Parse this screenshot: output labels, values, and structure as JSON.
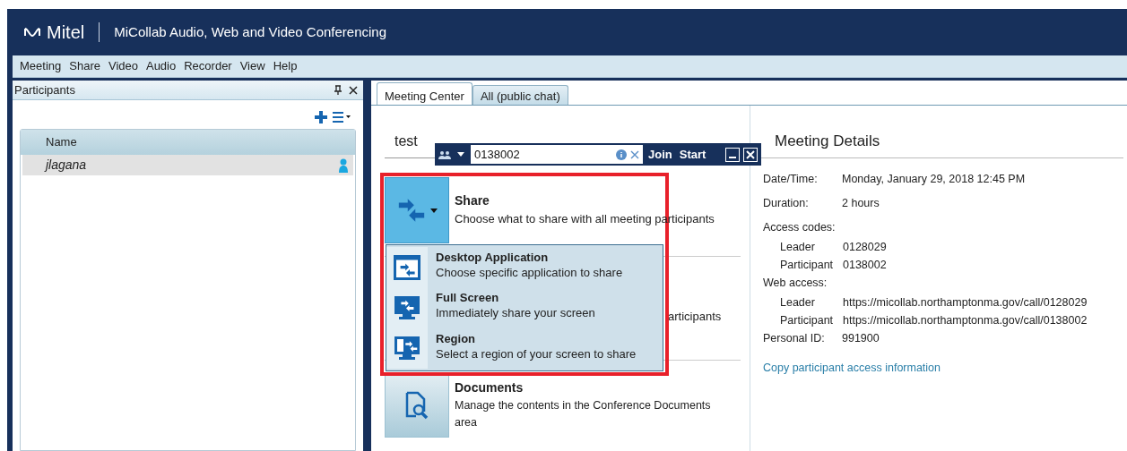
{
  "window": {
    "logo": "Mitel",
    "title": "MiCollab Audio, Web and Video Conferencing"
  },
  "menu": [
    "Meeting",
    "Share",
    "Video",
    "Audio",
    "Recorder",
    "View",
    "Help"
  ],
  "participants": {
    "title": "Participants",
    "column": "Name",
    "rows": [
      {
        "name": "jlagana",
        "selected": true
      }
    ]
  },
  "tabs": [
    {
      "label": "Meeting Center",
      "selected": true
    },
    {
      "label": "All (public chat)",
      "selected": false
    }
  ],
  "meeting": {
    "title": "test",
    "hidden_text": "articipants",
    "cards": [
      {
        "kind": "share",
        "title": "Share",
        "description": "Choose what to share with all meeting participants"
      },
      {
        "kind": "documents",
        "title": "Documents",
        "description": "Manage the contents in the Conference Documents area"
      }
    ]
  },
  "quick_bar": {
    "value": "0138002",
    "buttons": [
      "Join",
      "Start"
    ]
  },
  "share_menu": [
    {
      "kind": "application",
      "title": "Desktop Application",
      "description": "Choose specific application to share"
    },
    {
      "kind": "screen",
      "title": "Full Screen",
      "description": "Immediately share your screen"
    },
    {
      "kind": "region",
      "title": "Region",
      "description": "Select a region of your screen to share"
    }
  ],
  "details": {
    "title": "Meeting Details",
    "rows": [
      {
        "kind": "field",
        "label": "Date/Time:",
        "value": "Monday, January 29, 2018 12:45 PM"
      },
      {
        "kind": "field",
        "label": "Duration:",
        "value": "2 hours"
      },
      {
        "kind": "heading",
        "label": "Access codes:"
      },
      {
        "kind": "sub",
        "label": "Leader",
        "value": "0128029"
      },
      {
        "kind": "sub",
        "label": "Participant",
        "value": "0138002"
      },
      {
        "kind": "heading",
        "label": "Web access:"
      },
      {
        "kind": "sub",
        "label": "Leader",
        "value": "https://micollab.northamptonma.gov/call/0128029"
      },
      {
        "kind": "sub",
        "label": "Participant",
        "value": "https://micollab.northamptonma.gov/call/0138002"
      },
      {
        "kind": "field",
        "label": "Personal ID:",
        "value": "991900"
      }
    ],
    "link": "Copy participant access information"
  }
}
